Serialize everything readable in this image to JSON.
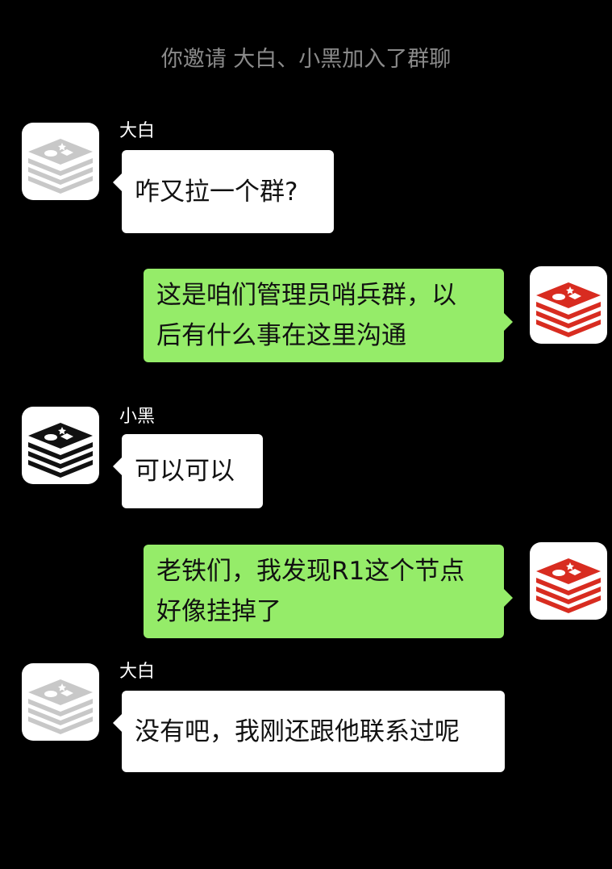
{
  "chat": {
    "system_notice": "你邀请 大白、小黑加入了群聊",
    "messages": [
      {
        "sender": "大白",
        "text": "咋又拉一个群?",
        "avatar_icon": "redis-logo-icon",
        "avatar_color": "#c8c8c8"
      },
      {
        "sender": "",
        "lines": [
          "这是咱们管理员哨兵群，以",
          "后有什么事在这里沟通"
        ],
        "avatar_icon": "redis-logo-icon",
        "avatar_color": "#d82c20"
      },
      {
        "sender": "小黑",
        "text": "可以可以",
        "avatar_icon": "redis-logo-icon",
        "avatar_color": "#111111"
      },
      {
        "sender": "",
        "lines": [
          "老铁们，我发现R1这个节点",
          "好像挂掉了"
        ],
        "avatar_icon": "redis-logo-icon",
        "avatar_color": "#d82c20"
      },
      {
        "sender": "大白",
        "text": "没有吧，我刚还跟他联系过呢",
        "avatar_icon": "redis-logo-icon",
        "avatar_color": "#c8c8c8"
      }
    ]
  },
  "colors": {
    "background": "#000000",
    "incoming_bubble": "#ffffff",
    "outgoing_bubble": "#95ec69",
    "system_text": "#8a8a8a"
  }
}
